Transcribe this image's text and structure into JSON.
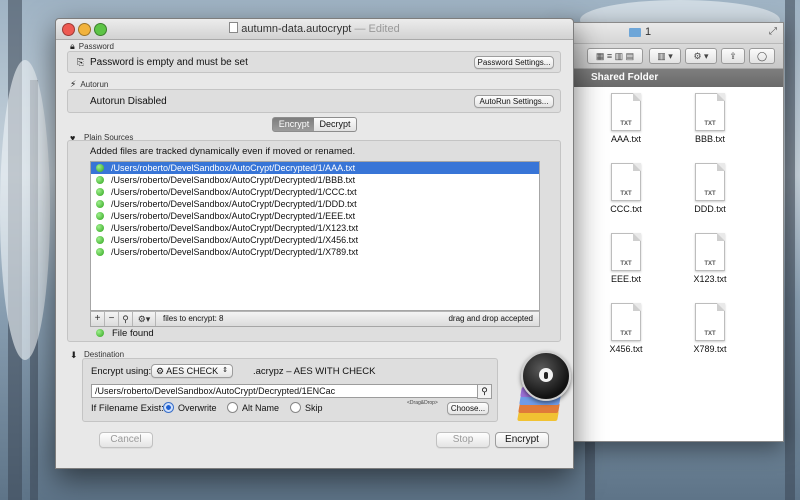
{
  "finder": {
    "title": "1",
    "header": "Shared Folder",
    "files": [
      {
        "name": "AAA.txt",
        "ext": "TXT"
      },
      {
        "name": "BBB.txt",
        "ext": "TXT"
      },
      {
        "name": "CCC.txt",
        "ext": "TXT"
      },
      {
        "name": "DDD.txt",
        "ext": "TXT"
      },
      {
        "name": "EEE.txt",
        "ext": "TXT"
      },
      {
        "name": "X123.txt",
        "ext": "TXT"
      },
      {
        "name": "X456.txt",
        "ext": "TXT"
      },
      {
        "name": "X789.txt",
        "ext": "TXT"
      }
    ]
  },
  "window": {
    "title": "autumn-data.autocrypt",
    "status": "— Edited",
    "traffic_colors": [
      "#ee5a52",
      "#f2b33c",
      "#5dc446"
    ]
  },
  "password": {
    "section_label": "Password",
    "message": "Password is empty and must be set",
    "settings_button": "Password Settings..."
  },
  "autorun": {
    "section_label": "Autorun",
    "message": "Autorun Disabled",
    "settings_button": "AutoRun Settings..."
  },
  "mode_tabs": {
    "encrypt": "Encrypt",
    "decrypt": "Decrypt",
    "selected": "Encrypt"
  },
  "sources": {
    "section_label": "Plain Sources",
    "info": "Added files are tracked dynamically  even if moved or renamed.",
    "files": [
      "/Users/roberto/DevelSandbox/AutoCrypt/Decrypted/1/AAA.txt",
      "/Users/roberto/DevelSandbox/AutoCrypt/Decrypted/1/BBB.txt",
      "/Users/roberto/DevelSandbox/AutoCrypt/Decrypted/1/CCC.txt",
      "/Users/roberto/DevelSandbox/AutoCrypt/Decrypted/1/DDD.txt",
      "/Users/roberto/DevelSandbox/AutoCrypt/Decrypted/1/EEE.txt",
      "/Users/roberto/DevelSandbox/AutoCrypt/Decrypted/1/X123.txt",
      "/Users/roberto/DevelSandbox/AutoCrypt/Decrypted/1/X456.txt",
      "/Users/roberto/DevelSandbox/AutoCrypt/Decrypted/1/X789.txt"
    ],
    "files_count_label": "files to encrypt: 8",
    "drag_hint": "drag and drop accepted",
    "status": "File found"
  },
  "destination": {
    "section_label": "Destination",
    "encrypt_using_label": "Encrypt using:",
    "method": "AES CHECK",
    "method_desc": ".acrypz – AES WITH CHECK",
    "path": "/Users/roberto/DevelSandbox/AutoCrypt/Decrypted/1ENCac",
    "if_exists_label": "If Filename Exist:",
    "options": [
      "Overwrite",
      "Alt Name",
      "Skip"
    ],
    "selected_option": "Overwrite",
    "drag_label": "<Drag&Drop>",
    "choose_button": "Choose..."
  },
  "footer": {
    "cancel": "Cancel",
    "stop": "Stop",
    "encrypt": "Encrypt"
  },
  "colors": {
    "selection": "#3875d7",
    "accent_blue": "#1e5fd1"
  }
}
